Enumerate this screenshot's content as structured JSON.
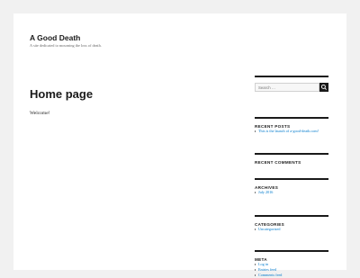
{
  "site": {
    "title": "A Good Death",
    "description": "A site dedicated to mourning the loss of death."
  },
  "main": {
    "page_title": "Home page",
    "body": "Welcome!"
  },
  "sidebar": {
    "search": {
      "placeholder": "Search …"
    },
    "recent_posts": {
      "title": "RECENT POSTS",
      "items": [
        "This is the launch of a-good-death.com!"
      ]
    },
    "recent_comments": {
      "title": "RECENT COMMENTS"
    },
    "archives": {
      "title": "ARCHIVES",
      "items": [
        "July 2016"
      ]
    },
    "categories": {
      "title": "CATEGORIES",
      "items": [
        "Uncategorized"
      ]
    },
    "meta": {
      "title": "META",
      "items": [
        "Log in",
        "Entries feed",
        "Comments feed"
      ]
    }
  },
  "colors": {
    "link": "#007acc",
    "text": "#1a1a1a",
    "background": "#f1f1f1"
  },
  "icons": {
    "search_button": "search-icon"
  }
}
